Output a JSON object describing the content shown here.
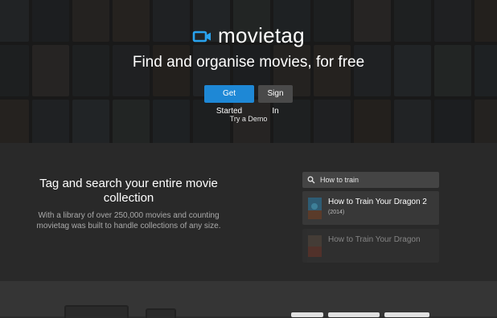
{
  "hero": {
    "brand": "movietag",
    "headline": "Find and organise movies, for free",
    "get_started_label": "Get Started",
    "sign_in_label": "Sign In",
    "demo_link": "Try a Demo",
    "poster_colors": [
      "#3a4048",
      "#2d3338",
      "#4a3f35",
      "#33383d",
      "#3f4a44",
      "#2a2f36",
      "#4b4540",
      "#353c42",
      "#40362e",
      "#2f3a40",
      "#463d38",
      "#30363c",
      "#3c444b"
    ]
  },
  "logo_icon": "camera-icon",
  "accent_color": "#1e88d6",
  "feature": {
    "title": "Tag and search your entire movie collection",
    "description": "With a library of over 250,000 movies and counting movietag was built to handle collections of any size."
  },
  "search": {
    "icon": "search-icon",
    "value": "How to train",
    "results": [
      {
        "title": "How to Train Your Dragon 2",
        "year": "(2014)"
      },
      {
        "title": "How to Train Your Dragon",
        "year": ""
      }
    ]
  }
}
